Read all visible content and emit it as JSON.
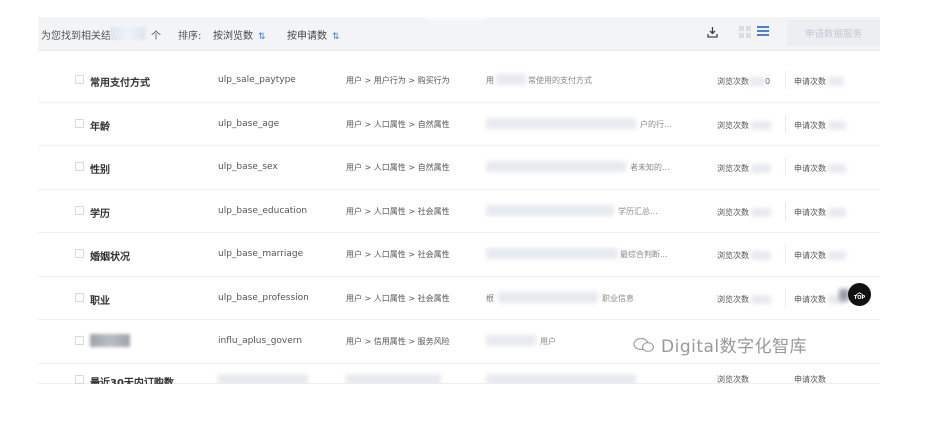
{
  "toolbar": {
    "result_prefix": "为您找到相关结果",
    "result_unit": "个",
    "sort_label": "排序:",
    "sort_options": [
      {
        "label": "按浏览数",
        "arrow": "⇅"
      },
      {
        "label": "按申请数",
        "arrow": "⇅"
      }
    ],
    "apply_button": "申请数据服务",
    "icons": [
      "download-icon",
      "grid-view-icon",
      "list-view-icon"
    ]
  },
  "rows": [
    {
      "name": "常用支付方式",
      "code": "ulp_sale_paytype",
      "path": "用户 > 用户行为 > 购买行为",
      "desc_start": "用",
      "desc_end": "常使用的支付方式",
      "views": "浏览次数",
      "views_tail": "0",
      "apps": "申请次数"
    },
    {
      "name": "年龄",
      "code": "ulp_base_age",
      "path": "用户 > 人口属性 > 自然属性",
      "desc_start": "",
      "desc_end": "户的行...",
      "views": "浏览次数",
      "views_tail": "",
      "apps": "申请次数"
    },
    {
      "name": "性别",
      "code": "ulp_base_sex",
      "path": "用户 > 人口属性 > 自然属性",
      "desc_start": "",
      "desc_end": "者未知的...",
      "views": "浏览次数",
      "views_tail": "",
      "apps": "申请次数"
    },
    {
      "name": "学历",
      "code": "ulp_base_education",
      "path": "用户 > 人口属性 > 社会属性",
      "desc_start": "",
      "desc_end": "学历汇总...",
      "views": "浏览次数",
      "views_tail": "",
      "apps": "申请次数"
    },
    {
      "name": "婚姻状况",
      "code": "ulp_base_marriage",
      "path": "用户 > 人口属性 > 社会属性",
      "desc_start": "",
      "desc_end": "最综合判断...",
      "views": "浏览次数",
      "views_tail": "",
      "apps": "申请次数"
    },
    {
      "name": "职业",
      "code": "ulp_base_profession",
      "path": "用户 > 人口属性 > 社会属性",
      "desc_start": "根",
      "desc_end": "职业信息",
      "views": "浏览次数",
      "views_tail": "",
      "apps": "申请次数"
    },
    {
      "name": "",
      "code": "influ_aplus_govern",
      "path": "用户 > 信用属性 > 服务风险",
      "desc_start": "",
      "desc_end": "用户",
      "views": "浏览次数",
      "views_tail": "",
      "apps": "申请次数"
    },
    {
      "name": "最近30天内订购数",
      "code": "",
      "path": "",
      "desc_start": "",
      "desc_end": "",
      "views": "浏览次数",
      "views_tail": "",
      "apps": "申请次数"
    }
  ],
  "top_button": {
    "label": "TOP"
  },
  "watermark": {
    "text": "Digital数字化智库"
  },
  "colors": {
    "accent": "#4b7fd8",
    "topbar_bg": "#f3f4f6",
    "button_disabled_bg": "#eceef2"
  }
}
